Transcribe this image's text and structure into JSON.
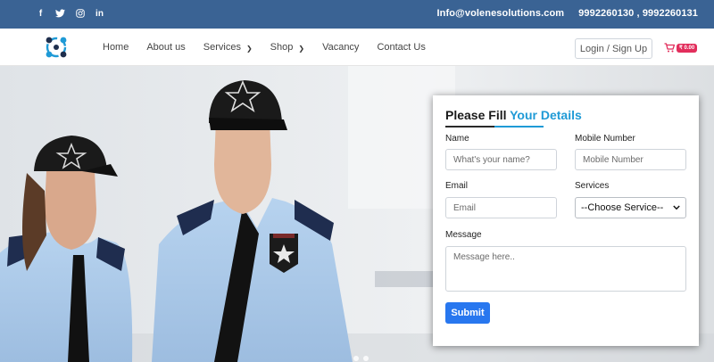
{
  "topbar": {
    "social": [
      {
        "icon": "facebook-icon",
        "glyph": "f"
      },
      {
        "icon": "twitter-icon",
        "glyph": "t"
      },
      {
        "icon": "instagram-icon",
        "glyph": "◎"
      },
      {
        "icon": "linkedin-icon",
        "glyph": "in"
      }
    ],
    "email": "Info@volenesolutions.com",
    "phones": "9992260130 , 9992260131"
  },
  "nav": {
    "items": [
      {
        "label": "Home",
        "dropdown": false
      },
      {
        "label": "About us",
        "dropdown": false
      },
      {
        "label": "Services",
        "dropdown": true
      },
      {
        "label": "Shop",
        "dropdown": true
      },
      {
        "label": "Vacancy",
        "dropdown": false
      },
      {
        "label": "Contact Us",
        "dropdown": false
      }
    ],
    "login_label": "Login / Sign Up",
    "cart_amount": "₹ 0.00"
  },
  "form": {
    "title_plain": "Please Fill",
    "title_accent": "Your Details",
    "name_label": "Name",
    "name_placeholder": "What's your name?",
    "mobile_label": "Mobile Number",
    "mobile_placeholder": "Mobile Number",
    "email_label": "Email",
    "email_placeholder": "Email",
    "services_label": "Services",
    "services_selected": "--Choose Service--",
    "message_label": "Message",
    "message_placeholder": "Message here..",
    "submit_label": "Submit"
  },
  "colors": {
    "topbar": "#3a6394",
    "accent": "#1f9ad6",
    "submit": "#2877ef",
    "cart_badge": "#e22e5c"
  }
}
